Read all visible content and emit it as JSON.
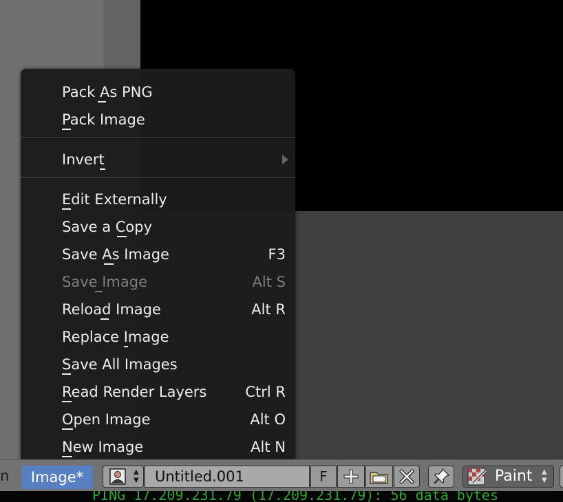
{
  "menu": {
    "items": [
      {
        "label": "Pack As PNG",
        "shortcut": ""
      },
      {
        "label": "Pack Image",
        "shortcut": ""
      },
      {
        "label": "Invert",
        "shortcut": "",
        "submenu": true
      },
      {
        "label": "Edit Externally",
        "shortcut": ""
      },
      {
        "label": "Save a Copy",
        "shortcut": ""
      },
      {
        "label": "Save As Image",
        "shortcut": "F3"
      },
      {
        "label": "Save Image",
        "shortcut": "Alt S",
        "disabled": true
      },
      {
        "label": "Reload Image",
        "shortcut": "Alt R"
      },
      {
        "label": "Replace Image",
        "shortcut": ""
      },
      {
        "label": "Save All Images",
        "shortcut": ""
      },
      {
        "label": "Read Render Layers",
        "shortcut": "Ctrl R"
      },
      {
        "label": "Open Image",
        "shortcut": "Alt O"
      },
      {
        "label": "New Image",
        "shortcut": "Alt N"
      }
    ]
  },
  "header": {
    "left_fragment": "n",
    "active_menu": "Image*",
    "image_name": "Untitled.001",
    "fake_user": "F",
    "mode": "Paint",
    "icons": [
      "image-browse-icon",
      "plus-icon",
      "folder-open-icon",
      "close-x-icon",
      "pin-icon",
      "paint-brush-icon"
    ]
  },
  "terminal": {
    "text": "PING 17.209.231.79 (17.209.231.79): 56 data bytes"
  },
  "colors": {
    "menu_bg": "#1c1c1c",
    "active_menu": "#5680c2",
    "terminal_text": "#2fa52f",
    "disabled_text": "#7e7e7e"
  }
}
